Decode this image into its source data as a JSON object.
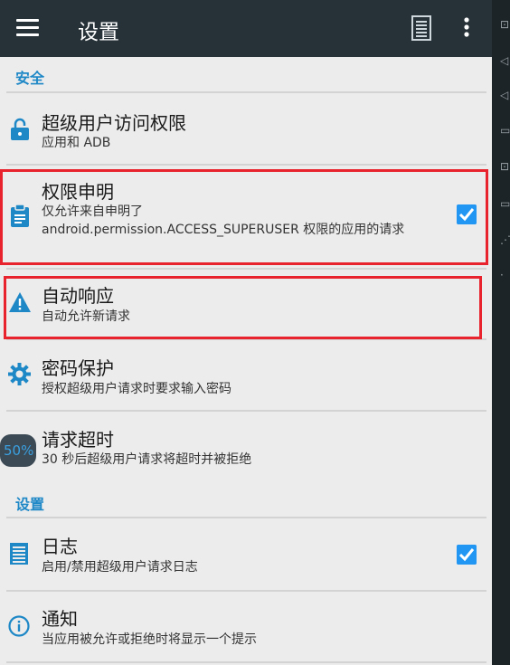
{
  "toolbar": {
    "title": "设置",
    "menu_icon": "menu-icon",
    "log_icon": "log-list-icon",
    "more_icon": "more-vert-icon",
    "background": "#263238"
  },
  "sections": {
    "security": "安全",
    "settings": "设置"
  },
  "items": [
    {
      "title": "超级用户访问权限",
      "subtitle": "应用和 ADB",
      "icon": "lock-icon"
    },
    {
      "title": "权限申明",
      "subtitle": "仅允许来自申明了\nandroid.permission.ACCESS_SUPERUSER 权限的应用的请求",
      "icon": "clipboard-icon",
      "checked": true
    },
    {
      "title": "自动响应",
      "subtitle": "自动允许新请求",
      "icon": "warning-icon"
    },
    {
      "title": "密码保护",
      "subtitle": "授权超级用户请求时要求输入密码",
      "icon": "gear-icon"
    },
    {
      "title": "请求超时",
      "subtitle": "30 秒后超级用户请求将超时并被拒绝",
      "icon": "timer-badge",
      "badge": "50%"
    },
    {
      "title": "日志",
      "subtitle": "启用/禁用超级用户请求日志",
      "icon": "log-icon",
      "checked": true
    },
    {
      "title": "通知",
      "subtitle": "当应用被允许或拒绝时将显示一个提示",
      "icon": "info-icon"
    }
  ],
  "colors": {
    "accent": "#1e88c7",
    "highlight": "#e8232e",
    "checkbox": "#2196f3"
  }
}
